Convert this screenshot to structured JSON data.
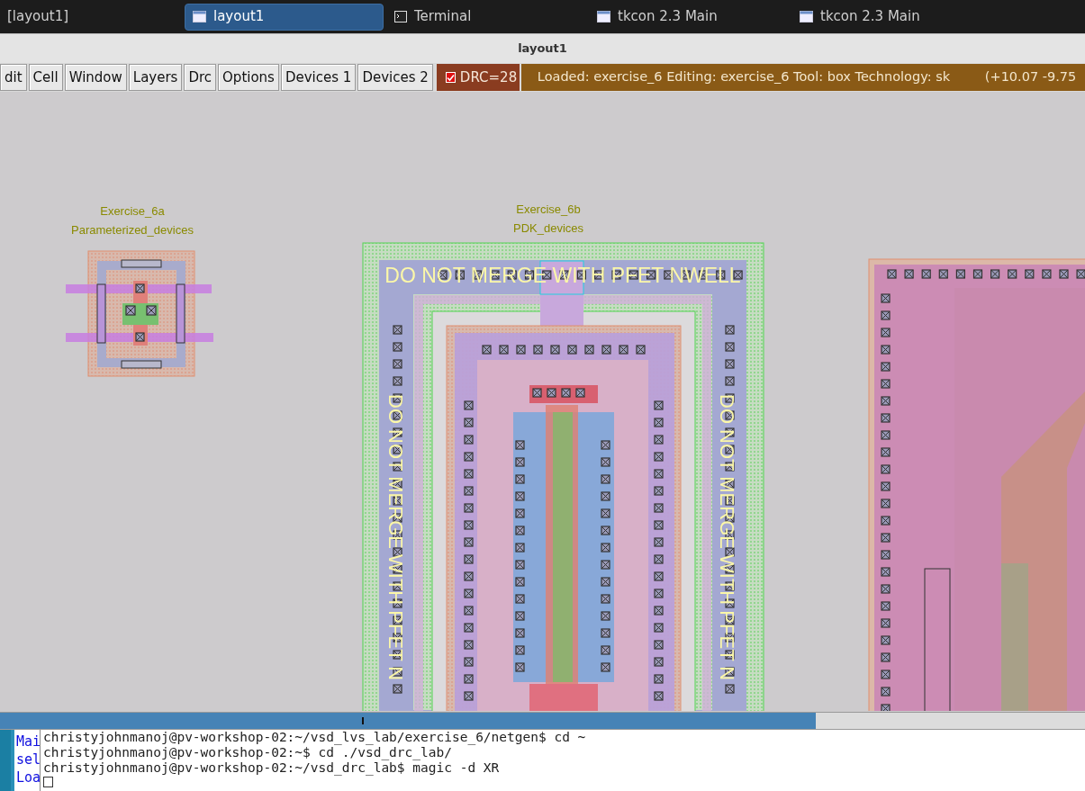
{
  "taskbar": {
    "tasks": [
      {
        "label": "[layout1]",
        "selected": false
      },
      {
        "label": "layout1",
        "selected": true
      },
      {
        "label": "Terminal",
        "selected": false
      },
      {
        "label": "tkcon 2.3 Main",
        "selected": false
      },
      {
        "label": "tkcon 2.3 Main",
        "selected": false
      }
    ]
  },
  "window": {
    "title": "layout1"
  },
  "menu": {
    "buttons": [
      "dit",
      "Cell",
      "Window",
      "Layers",
      "Drc",
      "Options",
      "Devices 1",
      "Devices 2"
    ]
  },
  "drc": {
    "label": "DRC=28",
    "checked": true
  },
  "status": {
    "text": "Loaded: exercise_6 Editing: exercise_6 Tool: box  Technology: sk",
    "coords": "(+10.07 -9.75"
  },
  "canvas": {
    "cells": [
      {
        "name": "Exercise_6a",
        "subtitle": "Parameterized_devices"
      },
      {
        "name": "Exercise_6b",
        "subtitle": "PDK_devices"
      }
    ],
    "warnings": [
      {
        "kind": "horizontal",
        "text": "DO NOT MERGE WITH PFET NWELL"
      },
      {
        "kind": "vertical",
        "text": "DO NOT MERGE WITH PFET N"
      },
      {
        "kind": "vertical",
        "text": "DO NOT MERGE WITH PFET N"
      }
    ]
  },
  "tkcon": {
    "lines": [
      "Mai",
      "sel",
      "Loa"
    ]
  },
  "terminal": {
    "lines": [
      "christyjohnmanoj@pv-workshop-02:~/vsd_lvs_lab/exercise_6/netgen$ cd ~",
      "christyjohnmanoj@pv-workshop-02:~$ cd ./vsd_drc_lab/",
      "christyjohnmanoj@pv-workshop-02:~/vsd_drc_lab$ magic -d XR"
    ]
  }
}
